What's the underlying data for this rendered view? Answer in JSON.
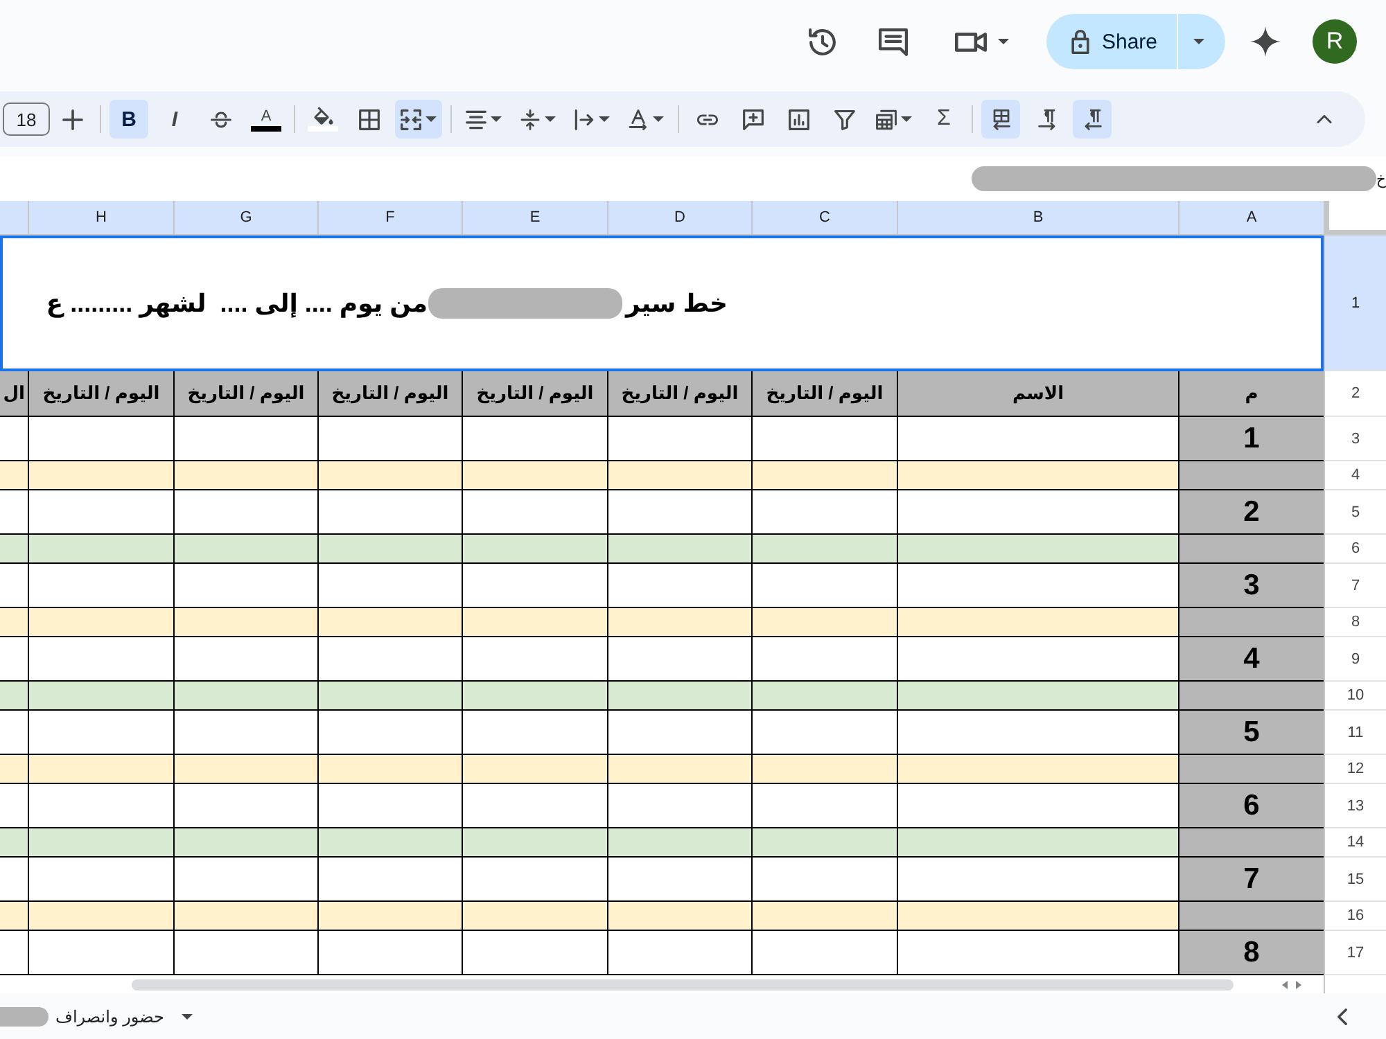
{
  "top_bar": {
    "actions": [
      {
        "kind": "history",
        "dropdown": false
      },
      {
        "kind": "comments",
        "dropdown": false
      },
      {
        "kind": "video-call",
        "dropdown": true
      }
    ],
    "share": {
      "label": "Share"
    },
    "avatar": {
      "letter": "R"
    }
  },
  "toolbar": {
    "font_size": "18",
    "groups": [
      [
        {
          "kind": "rtl-text",
          "selected": true,
          "dropdown": false
        },
        {
          "kind": "ltr-text",
          "selected": false,
          "dropdown": false
        },
        {
          "kind": "sheet-direction",
          "selected": true,
          "dropdown": false
        }
      ],
      [
        {
          "kind": "functions",
          "glyph": "Σ",
          "selected": false,
          "dropdown": false
        },
        {
          "kind": "filter-views",
          "selected": false,
          "dropdown": true
        },
        {
          "kind": "filter",
          "selected": false,
          "dropdown": false
        },
        {
          "kind": "chart",
          "selected": false,
          "dropdown": false
        },
        {
          "kind": "comment",
          "selected": false,
          "dropdown": false
        },
        {
          "kind": "link",
          "selected": false,
          "dropdown": false
        }
      ],
      [
        {
          "kind": "rotate",
          "selected": false,
          "dropdown": true
        },
        {
          "kind": "wrap",
          "selected": false,
          "dropdown": true
        },
        {
          "kind": "align-vertical",
          "selected": false,
          "dropdown": true
        },
        {
          "kind": "align-horizontal",
          "selected": false,
          "dropdown": true
        }
      ],
      [
        {
          "kind": "merge",
          "selected": true,
          "dropdown": true
        },
        {
          "kind": "borders",
          "selected": false,
          "dropdown": false
        },
        {
          "kind": "fill-color",
          "color": "#ffffff",
          "selected": false,
          "dropdown": false
        }
      ],
      [
        {
          "kind": "text-color",
          "glyph": "A",
          "color": "#000000",
          "selected": false,
          "dropdown": false
        },
        {
          "kind": "strikethrough",
          "selected": false,
          "dropdown": false
        },
        {
          "kind": "italic",
          "glyph": "I",
          "selected": false,
          "dropdown": false
        },
        {
          "kind": "bold",
          "glyph": "B",
          "selected": true,
          "dropdown": false
        }
      ],
      [
        {
          "kind": "increase",
          "selected": false,
          "dropdown": false
        }
      ]
    ]
  },
  "formula_bar": {
    "text": "خ"
  },
  "sheet": {
    "columns": [
      {
        "label": "A",
        "selected": true
      },
      {
        "label": "B",
        "selected": true
      },
      {
        "label": "C",
        "selected": true
      },
      {
        "label": "D",
        "selected": true
      },
      {
        "label": "E",
        "selected": true
      },
      {
        "label": "F",
        "selected": true
      },
      {
        "label": "G",
        "selected": true
      },
      {
        "label": "H",
        "selected": true
      }
    ],
    "rows": [
      {
        "number": "1",
        "kind": "title",
        "selected": true,
        "title_parts": [
          "خط سير",
          "من يوم .... إلى ....  لشهر ......... ع"
        ]
      },
      {
        "number": "2",
        "kind": "header",
        "selected": false,
        "cells": [
          "م",
          "الاسم",
          "اليوم / التاريخ",
          "اليوم / التاريخ",
          "اليوم / التاريخ",
          "اليوم / التاريخ",
          "اليوم / التاريخ",
          "اليوم / التاريخ",
          "ال"
        ]
      },
      {
        "number": "3",
        "kind": "entry",
        "selected": false,
        "cells": [
          "1"
        ]
      },
      {
        "number": "4",
        "kind": "band",
        "selected": false,
        "color": "#fff2cc"
      },
      {
        "number": "5",
        "kind": "entry",
        "selected": false,
        "cells": [
          "2"
        ]
      },
      {
        "number": "6",
        "kind": "band",
        "selected": false,
        "color": "#d9ead3"
      },
      {
        "number": "7",
        "kind": "entry",
        "selected": false,
        "cells": [
          "3"
        ]
      },
      {
        "number": "8",
        "kind": "band",
        "selected": false,
        "color": "#fff2cc"
      },
      {
        "number": "9",
        "kind": "entry",
        "selected": false,
        "cells": [
          "4"
        ]
      },
      {
        "number": "10",
        "kind": "band",
        "selected": false,
        "color": "#d9ead3"
      },
      {
        "number": "11",
        "kind": "entry",
        "selected": false,
        "cells": [
          "5"
        ]
      },
      {
        "number": "12",
        "kind": "band",
        "selected": false,
        "color": "#fff2cc"
      },
      {
        "number": "13",
        "kind": "entry",
        "selected": false,
        "cells": [
          "6"
        ]
      },
      {
        "number": "14",
        "kind": "band",
        "selected": false,
        "color": "#d9ead3"
      },
      {
        "number": "15",
        "kind": "entry",
        "selected": false,
        "cells": [
          "7"
        ]
      },
      {
        "number": "16",
        "kind": "band",
        "selected": false,
        "color": "#fff2cc"
      },
      {
        "number": "17",
        "kind": "entry",
        "selected": false,
        "cells": [
          "8"
        ]
      }
    ]
  },
  "sheet_tab": {
    "label": "حضور وانصراف"
  }
}
